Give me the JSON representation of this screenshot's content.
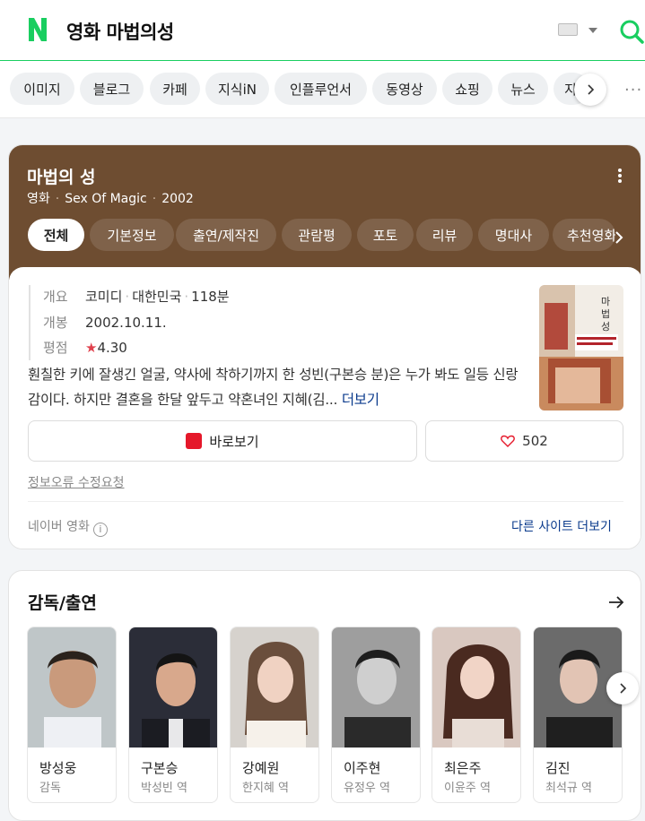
{
  "header": {
    "logo_icon": "naver-n-logo",
    "query": "영화 마법의성",
    "brand_color": "#19ce60"
  },
  "search_tabs": [
    {
      "label": "이미지"
    },
    {
      "label": "블로그"
    },
    {
      "label": "카페"
    },
    {
      "label": "지식iN"
    },
    {
      "label": "인플루언서"
    },
    {
      "label": "동영상"
    },
    {
      "label": "쇼핑"
    },
    {
      "label": "뉴스"
    },
    {
      "label": "지식"
    }
  ],
  "movie": {
    "title": "마법의 성",
    "category": "영화",
    "english_title": "Sex Of Magic",
    "year": "2002",
    "tabs": [
      {
        "label": "전체",
        "active": true
      },
      {
        "label": "기본정보"
      },
      {
        "label": "출연/제작진"
      },
      {
        "label": "관람평"
      },
      {
        "label": "포토"
      },
      {
        "label": "리뷰"
      },
      {
        "label": "명대사"
      },
      {
        "label": "추천영화"
      }
    ],
    "info": {
      "overview_label": "개요",
      "genre": "코미디",
      "country": "대한민국",
      "runtime": "118분",
      "release_label": "개봉",
      "release_date": "2002.10.11.",
      "rating_label": "평점",
      "rating_star": "★",
      "rating": "4.30"
    },
    "poster_title": "마법의성",
    "synopsis": "훤칠한 키에 잘생긴 얼굴, 약사에 착하기까지 한 성빈(구본승 분)은 누가 봐도 일등 신랑감이다. 하지만 결혼을 한달 앞두고 약혼녀인 지혜(김...",
    "synopsis_more": "더보기",
    "watch_button": "바로보기",
    "like_count": "502",
    "report_link": "정보오류 수정요청",
    "source": "네이버 영화",
    "other_sites": "다른 사이트 더보기",
    "header_color": "#6e4d31"
  },
  "cast": {
    "title": "감독/출연",
    "people": [
      {
        "name": "방성웅",
        "role": "감독"
      },
      {
        "name": "구본승",
        "role": "박성빈 역"
      },
      {
        "name": "강예원",
        "role": "한지혜 역"
      },
      {
        "name": "이주현",
        "role": "유정우 역"
      },
      {
        "name": "최은주",
        "role": "이윤주 역"
      },
      {
        "name": "김진",
        "role": "최석규 역"
      }
    ]
  }
}
